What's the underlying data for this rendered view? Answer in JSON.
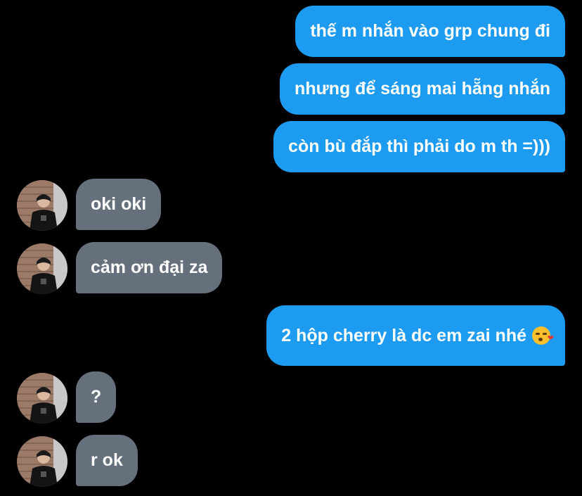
{
  "chat": {
    "messages": [
      {
        "sender": "me",
        "text": "thế m nhắn vào grp chung đi"
      },
      {
        "sender": "me",
        "text": "nhưng để sáng mai hẵng nhắn"
      },
      {
        "sender": "me",
        "text": "còn bù đắp thì phải do m th =)))"
      },
      {
        "sender": "them",
        "text": "oki oki"
      },
      {
        "sender": "them",
        "text": "cảm ơn đại za"
      },
      {
        "sender": "me",
        "text": "2 hộp cherry là dc em zai nhé",
        "emoji": "face-blowing-kiss-icon"
      },
      {
        "sender": "them",
        "text": "?"
      },
      {
        "sender": "them",
        "text": "r ok"
      }
    ]
  },
  "colors": {
    "background": "#000000",
    "outgoing_bubble": "#1d9bf0",
    "incoming_bubble": "#66707c",
    "text": "#ffffff"
  },
  "heart_glyph": "❤"
}
